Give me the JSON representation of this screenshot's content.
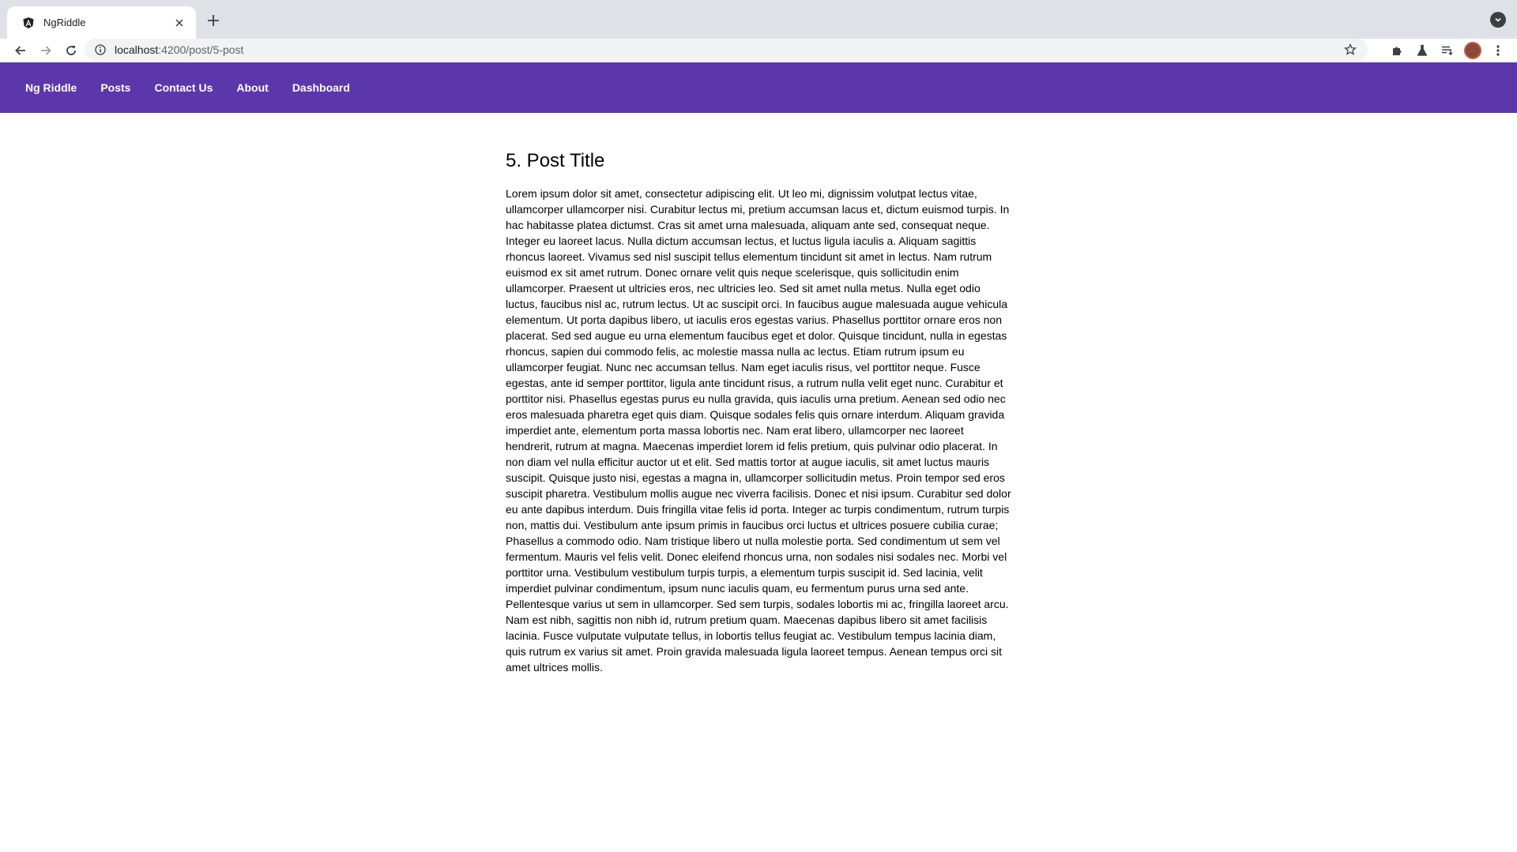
{
  "browser": {
    "tab_title": "NgRiddle",
    "url_host": "localhost",
    "url_rest": ":4200/post/5-post"
  },
  "nav": {
    "links": [
      "Ng Riddle",
      "Posts",
      "Contact Us",
      "About",
      "Dashboard"
    ],
    "bg_color": "#5c37ac"
  },
  "post": {
    "title": "5. Post Title",
    "body": "Lorem ipsum dolor sit amet, consectetur adipiscing elit. Ut leo mi, dignissim volutpat lectus vitae, ullamcorper ullamcorper nisi. Curabitur lectus mi, pretium accumsan lacus et, dictum euismod turpis. In hac habitasse platea dictumst. Cras sit amet urna malesuada, aliquam ante sed, consequat neque. Integer eu laoreet lacus. Nulla dictum accumsan lectus, et luctus ligula iaculis a. Aliquam sagittis rhoncus laoreet. Vivamus sed nisl suscipit tellus elementum tincidunt sit amet in lectus. Nam rutrum euismod ex sit amet rutrum. Donec ornare velit quis neque scelerisque, quis sollicitudin enim ullamcorper. Praesent ut ultricies eros, nec ultricies leo. Sed sit amet nulla metus. Nulla eget odio luctus, faucibus nisl ac, rutrum lectus. Ut ac suscipit orci. In faucibus augue malesuada augue vehicula elementum. Ut porta dapibus libero, ut iaculis eros egestas varius. Phasellus porttitor ornare eros non placerat. Sed sed augue eu urna elementum faucibus eget et dolor. Quisque tincidunt, nulla in egestas rhoncus, sapien dui commodo felis, ac molestie massa nulla ac lectus. Etiam rutrum ipsum eu ullamcorper feugiat. Nunc nec accumsan tellus. Nam eget iaculis risus, vel porttitor neque. Fusce egestas, ante id semper porttitor, ligula ante tincidunt risus, a rutrum nulla velit eget nunc. Curabitur et porttitor nisi. Phasellus egestas purus eu nulla gravida, quis iaculis urna pretium. Aenean sed odio nec eros malesuada pharetra eget quis diam. Quisque sodales felis quis ornare interdum. Aliquam gravida imperdiet ante, elementum porta massa lobortis nec. Nam erat libero, ullamcorper nec laoreet hendrerit, rutrum at magna. Maecenas imperdiet lorem id felis pretium, quis pulvinar odio placerat. In non diam vel nulla efficitur auctor ut et elit. Sed mattis tortor at augue iaculis, sit amet luctus mauris suscipit. Quisque justo nisi, egestas a magna in, ullamcorper sollicitudin metus. Proin tempor sed eros suscipit pharetra. Vestibulum mollis augue nec viverra facilisis. Donec et nisi ipsum. Curabitur sed dolor eu ante dapibus interdum. Duis fringilla vitae felis id porta. Integer ac turpis condimentum, rutrum turpis non, mattis dui. Vestibulum ante ipsum primis in faucibus orci luctus et ultrices posuere cubilia curae; Phasellus a commodo odio. Nam tristique libero ut nulla molestie porta. Sed condimentum ut sem vel fermentum. Mauris vel felis velit. Donec eleifend rhoncus urna, non sodales nisi sodales nec. Morbi vel porttitor urna. Vestibulum vestibulum turpis turpis, a elementum turpis suscipit id. Sed lacinia, velit imperdiet pulvinar condimentum, ipsum nunc iaculis quam, eu fermentum purus urna sed ante. Pellentesque varius ut sem in ullamcorper. Sed sem turpis, sodales lobortis mi ac, fringilla laoreet arcu. Nam est nibh, sagittis non nibh id, rutrum pretium quam. Maecenas dapibus libero sit amet facilisis lacinia. Fusce vulputate vulputate tellus, in lobortis tellus feugiat ac. Vestibulum tempus lacinia diam, quis rutrum ex varius sit amet. Proin gravida malesuada ligula laoreet tempus. Aenean tempus orci sit amet ultrices mollis."
  }
}
